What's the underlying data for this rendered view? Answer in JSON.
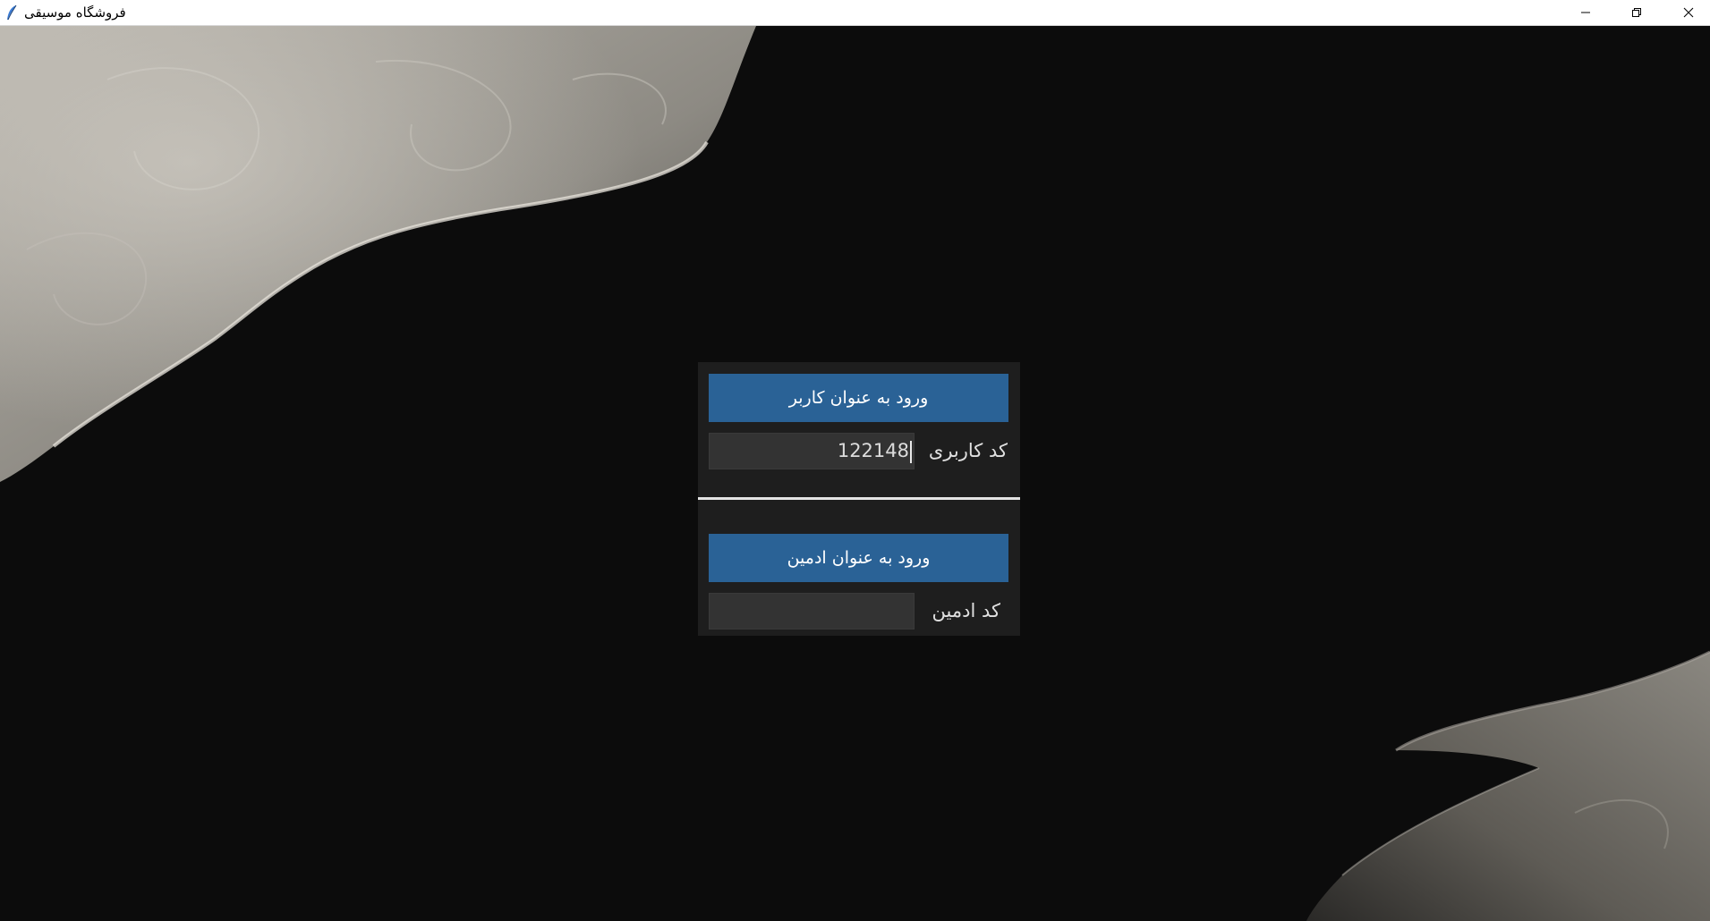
{
  "window": {
    "title": "فروشگاه موسیقی",
    "app_icon": "feather-icon",
    "controls": [
      "minimize-icon",
      "restore-icon",
      "close-icon"
    ]
  },
  "login_panel": {
    "user_section": {
      "button_label": "ورود به عنوان کاربر",
      "field_label": "کد کاربری",
      "field_value": "122148"
    },
    "admin_section": {
      "button_label": "ورود به عنوان ادمین",
      "field_label": "کد ادمین",
      "field_value": ""
    }
  },
  "colors": {
    "button": "#2a6296",
    "panel": "#1e1e1e",
    "input": "#333333",
    "background": "#0c0c0c"
  }
}
